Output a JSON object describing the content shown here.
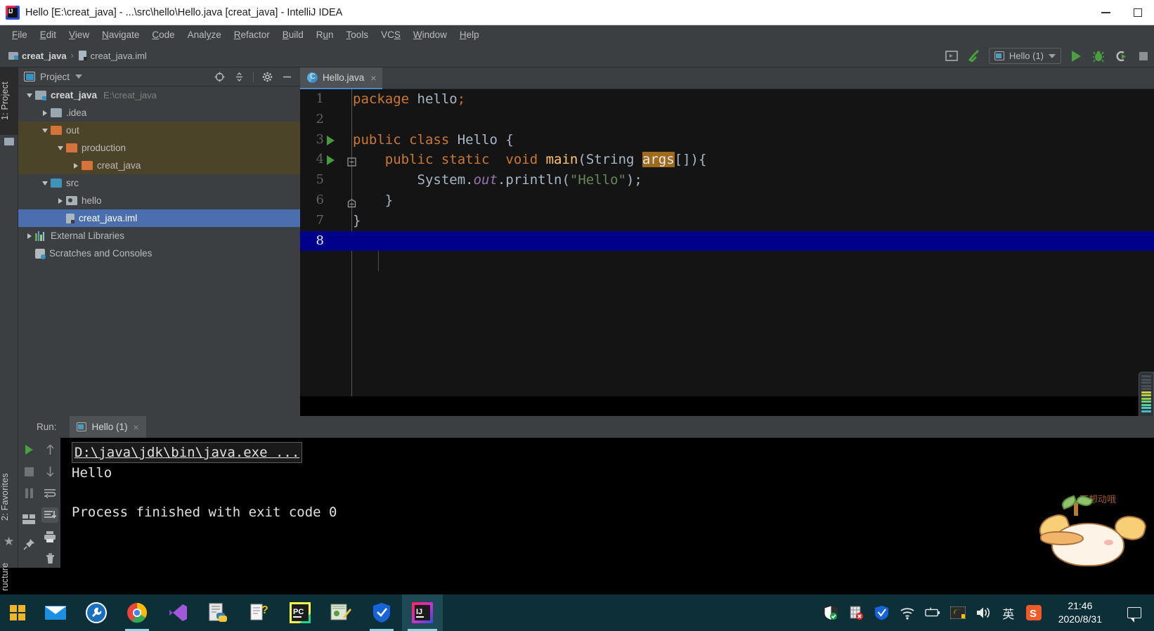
{
  "window": {
    "title": "Hello [E:\\creat_java] - ...\\src\\hello\\Hello.java [creat_java] - IntelliJ IDEA",
    "app_icon": "intellij-idea-logo",
    "minimize_label": "Minimize",
    "maximize_label": "Maximize"
  },
  "menubar": {
    "items": [
      {
        "label": "File",
        "mnemonic": "F"
      },
      {
        "label": "Edit",
        "mnemonic": "E"
      },
      {
        "label": "View",
        "mnemonic": "V"
      },
      {
        "label": "Navigate",
        "mnemonic": "N"
      },
      {
        "label": "Code",
        "mnemonic": "C"
      },
      {
        "label": "Analyze",
        "mnemonic": "y"
      },
      {
        "label": "Refactor",
        "mnemonic": "R"
      },
      {
        "label": "Build",
        "mnemonic": "B"
      },
      {
        "label": "Run",
        "mnemonic": "u"
      },
      {
        "label": "Tools",
        "mnemonic": "T"
      },
      {
        "label": "VCS",
        "mnemonic": "S"
      },
      {
        "label": "Window",
        "mnemonic": "W"
      },
      {
        "label": "Help",
        "mnemonic": "H"
      }
    ]
  },
  "navbar": {
    "breadcrumbs": [
      {
        "label": "creat_java",
        "icon": "module-folder-icon",
        "bold": true
      },
      {
        "label": "creat_java.iml",
        "icon": "iml-file-icon",
        "bold": false
      }
    ],
    "separator": "›",
    "toolbar": {
      "run_config_name": "Hello (1)",
      "run_config_icon": "application-config-icon",
      "buttons": [
        {
          "name": "select-run-config-icon",
          "label": "Select Run/Debug Configuration"
        },
        {
          "name": "build-hammer-icon",
          "label": "Build Project"
        },
        {
          "name": "run-button",
          "label": "Run"
        },
        {
          "name": "debug-button",
          "label": "Debug"
        },
        {
          "name": "run-with-coverage-button",
          "label": "Run with Coverage"
        }
      ]
    }
  },
  "left_strip": {
    "project_tab": "1: Project",
    "favorites_tab": "2: Favorites",
    "structure_tab": "ructure"
  },
  "project_panel": {
    "title": "Project",
    "title_icon": "project-view-icon",
    "actions": [
      {
        "name": "locate-target-icon",
        "label": "Select Opened File"
      },
      {
        "name": "collapse-all-icon",
        "label": "Collapse All"
      },
      {
        "name": "settings-gear-icon",
        "label": "Settings"
      },
      {
        "name": "hide-panel-icon",
        "label": "Hide"
      }
    ],
    "tree": [
      {
        "label": "creat_java",
        "path": "E:\\creat_java",
        "icon": "module-folder-icon",
        "indent": 0,
        "twisty": "down",
        "bold": true,
        "state": "normal"
      },
      {
        "label": ".idea",
        "path": "",
        "icon": "folder-gray-icon",
        "indent": 1,
        "twisty": "right",
        "bold": false,
        "state": "normal"
      },
      {
        "label": "out",
        "path": "",
        "icon": "folder-orange-icon",
        "indent": 1,
        "twisty": "down",
        "bold": false,
        "state": "excluded"
      },
      {
        "label": "production",
        "path": "",
        "icon": "folder-orange-icon",
        "indent": 2,
        "twisty": "down",
        "bold": false,
        "state": "excluded"
      },
      {
        "label": "creat_java",
        "path": "",
        "icon": "folder-orange-icon",
        "indent": 3,
        "twisty": "right",
        "bold": false,
        "state": "excluded"
      },
      {
        "label": "src",
        "path": "",
        "icon": "folder-source-icon",
        "indent": 1,
        "twisty": "down",
        "bold": false,
        "state": "normal"
      },
      {
        "label": "hello",
        "path": "",
        "icon": "package-icon",
        "indent": 2,
        "twisty": "right",
        "bold": false,
        "state": "normal"
      },
      {
        "label": "creat_java.iml",
        "path": "",
        "icon": "iml-file-icon",
        "indent": 2,
        "twisty": "none",
        "bold": false,
        "state": "selected"
      },
      {
        "label": "External Libraries",
        "path": "",
        "icon": "libraries-icon",
        "indent": 0,
        "twisty": "right",
        "bold": false,
        "state": "normal"
      },
      {
        "label": "Scratches and Consoles",
        "path": "",
        "icon": "scratches-icon",
        "indent": 0,
        "twisty": "none",
        "bold": false,
        "state": "normal"
      }
    ]
  },
  "editor": {
    "tabs": [
      {
        "label": "Hello.java",
        "icon": "java-class-icon",
        "active": true,
        "close_glyph": "×"
      }
    ],
    "current_line": 8,
    "lines": [
      {
        "num": "1",
        "run_marker": false,
        "text": "package hello;"
      },
      {
        "num": "2",
        "run_marker": false,
        "text": ""
      },
      {
        "num": "3",
        "run_marker": true,
        "text": "public class Hello {"
      },
      {
        "num": "4",
        "run_marker": true,
        "text": "    public static  void main(String args[]){"
      },
      {
        "num": "5",
        "run_marker": false,
        "text": "        System.out.println(\"Hello\");"
      },
      {
        "num": "6",
        "run_marker": false,
        "text": "    }"
      },
      {
        "num": "7",
        "run_marker": false,
        "text": "}"
      },
      {
        "num": "8",
        "run_marker": false,
        "text": ""
      }
    ],
    "code_tokens": {
      "l1": {
        "kw": "package",
        "rest": " hello;"
      },
      "l3": {
        "kw1": "public",
        "kw2": "class",
        "name": "Hello",
        "brace": "{"
      },
      "l4": {
        "kw1": "public",
        "kw2": "static",
        "kw3": "void",
        "fn": "main",
        "p1": "(String ",
        "hl": "args",
        "p2": "[]){"
      },
      "l5": {
        "obj": "System.",
        "field": "out",
        "dot": ".",
        "fn": "println",
        "open": "(",
        "str": "\"Hello\"",
        "close": ");"
      },
      "l6": {
        "text": "}"
      },
      "l7": {
        "text": "}"
      }
    }
  },
  "run_window": {
    "label": "Run:",
    "tab": {
      "label": "Hello (1)",
      "icon": "application-config-icon",
      "close_glyph": "×"
    },
    "toolbar": [
      {
        "name": "rerun-button",
        "label": "Rerun"
      },
      {
        "name": "stop-button",
        "label": "Stop"
      },
      {
        "name": "pause-button",
        "label": "Pause Output"
      },
      {
        "name": "layout-button",
        "label": "Layout Settings"
      },
      {
        "name": "pin-tab-button",
        "label": "Pin Tab"
      },
      {
        "name": "up-stacktrace-button",
        "label": "Up the Stack Trace"
      },
      {
        "name": "down-stacktrace-button",
        "label": "Down the Stack Trace"
      },
      {
        "name": "soft-wrap-button",
        "label": "Use Soft Wraps"
      },
      {
        "name": "scroll-to-end-button",
        "label": "Scroll to End"
      },
      {
        "name": "print-button",
        "label": "Print"
      },
      {
        "name": "clear-all-button",
        "label": "Clear All"
      }
    ],
    "console": {
      "command": "D:\\java\\jdk\\bin\\java.exe ...",
      "output": "Hello",
      "exit_message": "Process finished with exit code 0"
    }
  },
  "overlay": {
    "mascot_text": "不想动哦"
  },
  "taskbar": {
    "start_label": "Start",
    "apps": [
      {
        "name": "taskbar-mail-icon",
        "label": "Mail",
        "running": false
      },
      {
        "name": "taskbar-tool-icon",
        "label": "Driver Tool",
        "running": false
      },
      {
        "name": "taskbar-chrome-icon",
        "label": "Google Chrome",
        "running": true
      },
      {
        "name": "taskbar-vscode-icon",
        "label": "Visual Studio Code",
        "running": false
      },
      {
        "name": "taskbar-python-icon",
        "label": "Python",
        "running": false
      },
      {
        "name": "taskbar-notes-icon",
        "label": "Notes",
        "running": false
      },
      {
        "name": "taskbar-pycharm-icon",
        "label": "PyCharm",
        "running": false
      },
      {
        "name": "taskbar-editor-icon",
        "label": "Editor",
        "running": false
      },
      {
        "name": "taskbar-shield-icon",
        "label": "Security",
        "running": true
      },
      {
        "name": "taskbar-intellij-icon",
        "label": "IntelliJ IDEA",
        "running": true,
        "active": true
      }
    ],
    "tray": [
      {
        "name": "tray-defender-icon",
        "label": "Windows Security"
      },
      {
        "name": "tray-antivirus-icon",
        "label": "Antivirus"
      },
      {
        "name": "tray-shield-blue-icon",
        "label": "Tencent PC Manager"
      },
      {
        "name": "tray-wifi-icon",
        "label": "Network"
      },
      {
        "name": "tray-battery-icon",
        "label": "Battery"
      },
      {
        "name": "tray-nvidia-icon",
        "label": "NVIDIA Settings"
      },
      {
        "name": "tray-volume-icon",
        "label": "Volume"
      },
      {
        "name": "tray-ime-icon",
        "label": "英"
      },
      {
        "name": "tray-sogou-icon",
        "label": "Sogou Input"
      }
    ],
    "ime_label": "英",
    "sogou_label": "S",
    "clock_time": "21:46",
    "clock_date": "2020/8/31",
    "notification_label": "Notifications"
  },
  "colors": {
    "accent_blue": "#4b6eaf",
    "panel_bg": "#3c3f41",
    "editor_bg": "#141414",
    "caret_line": "#00008b",
    "keyword_orange": "#cc7832",
    "string_green": "#6a8759",
    "method_yellow": "#ffc66d",
    "field_purple": "#9876aa",
    "highlight_amber": "#9e6b1d",
    "taskbar_bg": "#0d3038",
    "excluded_folder": "#4b4429"
  }
}
